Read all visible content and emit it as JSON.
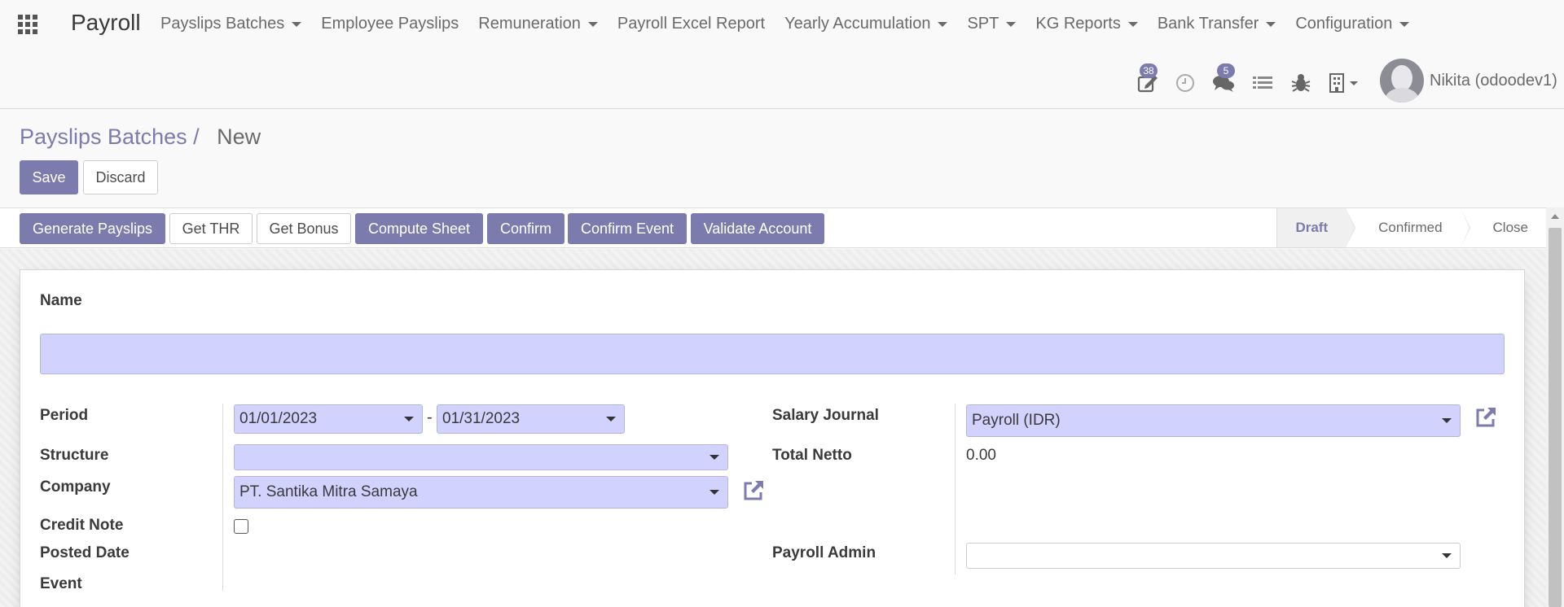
{
  "navbar": {
    "brand": "Payroll",
    "menu": [
      {
        "label": "Payslips Batches",
        "dropdown": true
      },
      {
        "label": "Employee Payslips",
        "dropdown": false
      },
      {
        "label": "Remuneration",
        "dropdown": true
      },
      {
        "label": "Payroll Excel Report",
        "dropdown": false
      },
      {
        "label": "Yearly Accumulation",
        "dropdown": true
      },
      {
        "label": "SPT",
        "dropdown": true
      },
      {
        "label": "KG Reports",
        "dropdown": true
      },
      {
        "label": "Bank Transfer",
        "dropdown": true
      },
      {
        "label": "Configuration",
        "dropdown": true
      }
    ],
    "systray": {
      "activities_count": "38",
      "messages_count": "5",
      "icons": [
        "edit-icon",
        "clock-icon",
        "chat-icon",
        "list-icon",
        "bug-icon",
        "building-icon"
      ],
      "user_name": "Nikita (odoodev1)"
    }
  },
  "control_panel": {
    "breadcrumb_parent": "Payslips Batches",
    "breadcrumb_separator": "/",
    "breadcrumb_current": "New",
    "save_label": "Save",
    "discard_label": "Discard"
  },
  "statusbar": {
    "buttons": {
      "generate_payslips": "Generate Payslips",
      "get_thr": "Get THR",
      "get_bonus": "Get Bonus",
      "compute_sheet": "Compute Sheet",
      "confirm": "Confirm",
      "confirm_event": "Confirm Event",
      "validate_account": "Validate Account"
    },
    "stages": [
      "Draft",
      "Confirmed",
      "Close"
    ],
    "active_stage": "Draft"
  },
  "form": {
    "name_label": "Name",
    "name_value": "",
    "period_label": "Period",
    "period_start": "01/01/2023",
    "period_separator": "-",
    "period_end": "01/31/2023",
    "structure_label": "Structure",
    "structure_value": "",
    "company_label": "Company",
    "company_value": "PT. Santika Mitra Samaya",
    "credit_note_label": "Credit Note",
    "credit_note_checked": false,
    "posted_date_label": "Posted Date",
    "event_label": "Event",
    "salary_journal_label": "Salary Journal",
    "salary_journal_value": "Payroll (IDR)",
    "total_netto_label": "Total Netto",
    "total_netto_value": "0.00",
    "payroll_admin_label": "Payroll Admin",
    "payroll_admin_value": ""
  },
  "colors": {
    "primary": "#7c7bad",
    "required_field_bg": "#d2d2ff",
    "text": "#4c4c4c"
  }
}
